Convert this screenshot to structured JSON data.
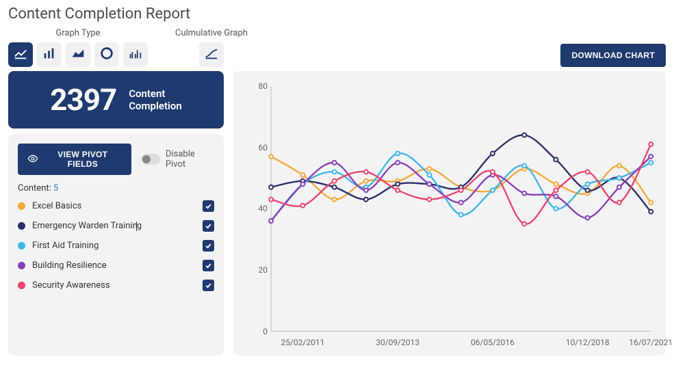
{
  "title": "Content Completion Report",
  "graph_type_label": "Graph Type",
  "cumulative_label": "Culmulative Graph",
  "download_label": "DOWNLOAD CHART",
  "kpi": {
    "value": "2397",
    "label_line1": "Content",
    "label_line2": "Completion"
  },
  "pivot": {
    "button_label": "VIEW PIVOT FIELDS",
    "disable_label": "Disable Pivot",
    "content_prefix": "Content: ",
    "content_count": "5"
  },
  "series_colors": {
    "excel_basics": "#f4a93c",
    "emergency_warden": "#2a2e66",
    "first_aid": "#3fb6e8",
    "building_resilience": "#8a3fb8",
    "security_awareness": "#e9456b"
  },
  "legend": [
    {
      "label": "Excel Basics",
      "color": "#f4a93c",
      "key": "excel_basics"
    },
    {
      "label": "Emergency Warden Training",
      "color": "#2a2e66",
      "key": "emergency_warden"
    },
    {
      "label": "First Aid Training",
      "color": "#3fb6e8",
      "key": "first_aid"
    },
    {
      "label": "Building Resilience",
      "color": "#8a3fb8",
      "key": "building_resilience"
    },
    {
      "label": "Security Awareness",
      "color": "#e9456b",
      "key": "security_awareness"
    }
  ],
  "chart_data": {
    "type": "line",
    "xlabel": "",
    "ylabel": "",
    "ylim": [
      0,
      80
    ],
    "y_ticks": [
      0,
      20,
      40,
      60,
      80
    ],
    "x_tick_labels": [
      "25/02/2011",
      "30/09/2013",
      "06/05/2016",
      "10/12/2018",
      "16/07/2021"
    ],
    "x": [
      0,
      1,
      2,
      3,
      4,
      5,
      6,
      7,
      8,
      9,
      10,
      11,
      12
    ],
    "series": [
      {
        "name": "Excel Basics",
        "color": "#f4a93c",
        "values": [
          57,
          51,
          43,
          49,
          49,
          53,
          47,
          46,
          53,
          48,
          45,
          54,
          42
        ]
      },
      {
        "name": "Emergency Warden Training",
        "color": "#2a2e66",
        "values": [
          47,
          49,
          47,
          43,
          48,
          48,
          47,
          58,
          64,
          56,
          46,
          50,
          39
        ]
      },
      {
        "name": "First Aid Training",
        "color": "#3fb6e8",
        "values": [
          36,
          48,
          52,
          47,
          58,
          51,
          38,
          46,
          54,
          40,
          48,
          50,
          55
        ]
      },
      {
        "name": "Building Resilience",
        "color": "#8a3fb8",
        "values": [
          36,
          48,
          55,
          46,
          55,
          48,
          42,
          51,
          45,
          44,
          37,
          47,
          57
        ]
      },
      {
        "name": "Security Awareness",
        "color": "#e9456b",
        "values": [
          43,
          41,
          49,
          52,
          46,
          43,
          46,
          52,
          35,
          46,
          52,
          42,
          61
        ]
      }
    ]
  }
}
